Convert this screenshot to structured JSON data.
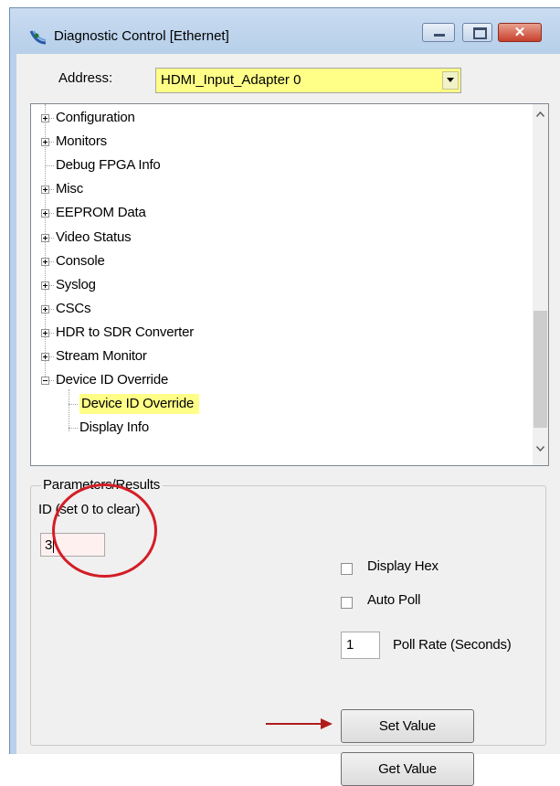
{
  "window": {
    "title": "Diagnostic Control [Ethernet]",
    "close_glyph": "✕",
    "icon": "satellite-dish-icon"
  },
  "address": {
    "label": "Address:",
    "value": "HDMI_Input_Adapter 0",
    "highlight_color": "#ffff88"
  },
  "tree": {
    "items": [
      {
        "label": "Configuration",
        "level": 0,
        "expander": "plus"
      },
      {
        "label": "Monitors",
        "level": 0,
        "expander": "plus"
      },
      {
        "label": "Debug FPGA Info",
        "level": 0,
        "expander": "none"
      },
      {
        "label": "Misc",
        "level": 0,
        "expander": "plus"
      },
      {
        "label": "EEPROM Data",
        "level": 0,
        "expander": "plus"
      },
      {
        "label": "Video Status",
        "level": 0,
        "expander": "plus"
      },
      {
        "label": "Console",
        "level": 0,
        "expander": "plus"
      },
      {
        "label": "Syslog",
        "level": 0,
        "expander": "plus"
      },
      {
        "label": "CSCs",
        "level": 0,
        "expander": "plus"
      },
      {
        "label": "HDR to SDR Converter",
        "level": 0,
        "expander": "plus"
      },
      {
        "label": "Stream Monitor",
        "level": 0,
        "expander": "plus"
      },
      {
        "label": "Device ID Override",
        "level": 0,
        "expander": "minus"
      },
      {
        "label": "Device ID Override",
        "level": 1,
        "expander": "none",
        "selected": true
      },
      {
        "label": "Display Info",
        "level": 1,
        "expander": "none"
      }
    ]
  },
  "params": {
    "title": "Parameters/Results",
    "id_label": "ID (set 0 to clear)",
    "id_value": "3",
    "display_hex_label": "Display Hex",
    "display_hex_checked": false,
    "auto_poll_label": "Auto Poll",
    "auto_poll_checked": false,
    "poll_rate_value": "1",
    "poll_rate_label": "Poll Rate (Seconds)",
    "set_value_label": "Set Value",
    "get_value_label": "Get Value"
  },
  "annotations": {
    "circle_color": "#d41d25",
    "arrow_color": "#b01c1c"
  }
}
